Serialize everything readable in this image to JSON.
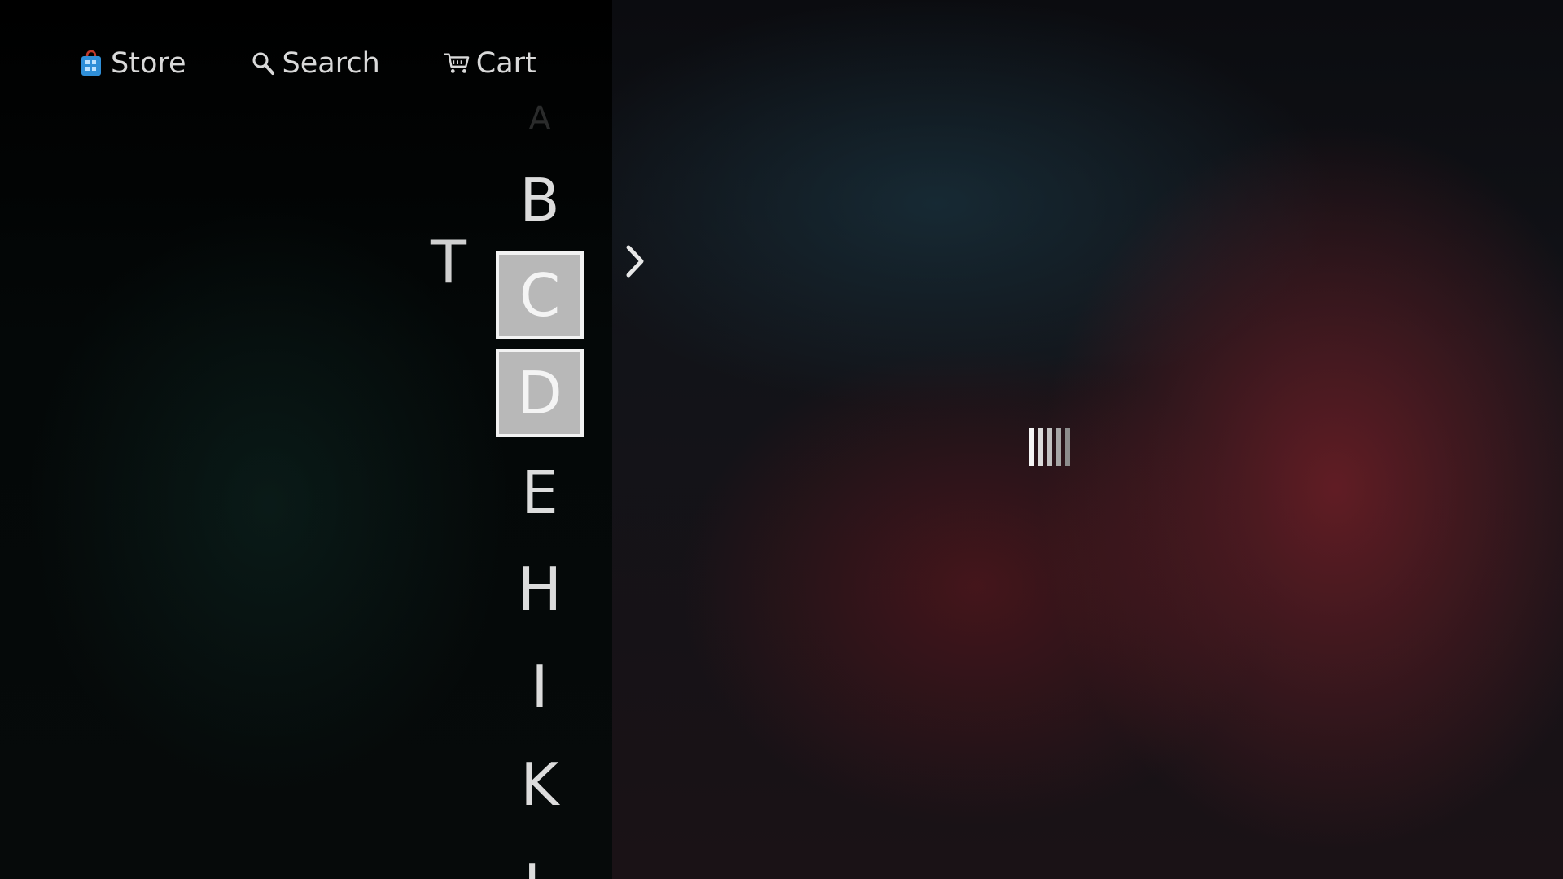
{
  "nav": {
    "store_label": "Store",
    "search_label": "Search",
    "cart_label": "Cart",
    "store_icon": "shopping-bag-icon",
    "search_icon": "search-icon",
    "cart_icon": "cart-icon"
  },
  "alphabet": {
    "side_letter": "T",
    "letters": [
      "A",
      "B",
      "C",
      "D",
      "E",
      "H",
      "I",
      "K",
      "L"
    ],
    "focused": [
      "C",
      "D"
    ]
  },
  "main": {
    "expand_icon": "chevron-right-icon",
    "loading_icon": "loading-bars-icon"
  },
  "colors": {
    "accent_blue": "#2f8fd8",
    "text": "#d9d9d9",
    "focus_fill": "#b8b8b8",
    "focus_border": "#f2f2f2"
  }
}
